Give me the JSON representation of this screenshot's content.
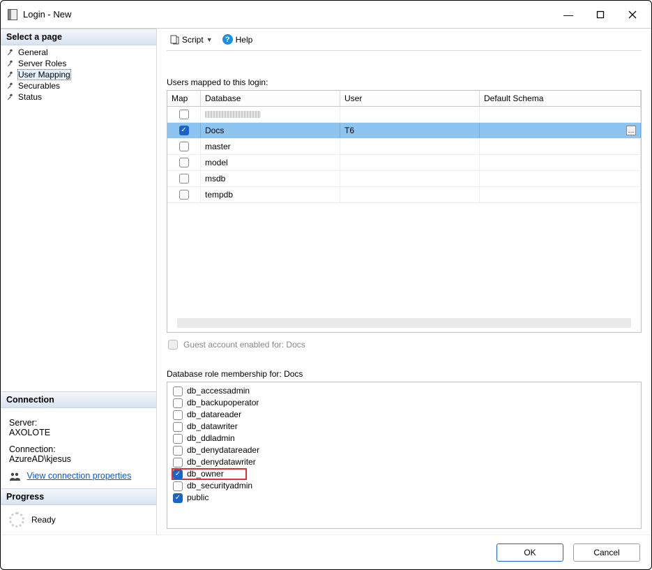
{
  "window": {
    "title": "Login - New",
    "min": "—",
    "max": "▢",
    "close": "✕"
  },
  "left": {
    "pages_header": "Select a page",
    "pages": [
      {
        "label": "General"
      },
      {
        "label": "Server Roles"
      },
      {
        "label": "User Mapping",
        "selected": true
      },
      {
        "label": "Securables"
      },
      {
        "label": "Status"
      }
    ],
    "conn_header": "Connection",
    "server_lbl": "Server:",
    "server_val": "AXOLOTE",
    "connection_lbl": "Connection:",
    "connection_val": "AzureAD\\kjesus",
    "view_props": "View connection properties",
    "progress_header": "Progress",
    "progress_status": "Ready"
  },
  "toolbar": {
    "script": "Script",
    "help": "Help"
  },
  "map": {
    "label": "Users mapped to this login:",
    "cols": {
      "map": "Map",
      "db": "Database",
      "user": "User",
      "schema": "Default Schema"
    },
    "rows": [
      {
        "checked": false,
        "db": "",
        "user": "",
        "schema": "",
        "redacted": true
      },
      {
        "checked": true,
        "db": "Docs",
        "user": "T6",
        "schema": "",
        "selected": true,
        "ellipsis": true
      },
      {
        "checked": false,
        "db": "master",
        "user": "",
        "schema": ""
      },
      {
        "checked": false,
        "db": "model",
        "user": "",
        "schema": ""
      },
      {
        "checked": false,
        "db": "msdb",
        "user": "",
        "schema": ""
      },
      {
        "checked": false,
        "db": "tempdb",
        "user": "",
        "schema": ""
      }
    ],
    "guest_label": "Guest account enabled for: Docs"
  },
  "roles": {
    "label": "Database role membership for: Docs",
    "items": [
      {
        "name": "db_accessadmin",
        "checked": false
      },
      {
        "name": "db_backupoperator",
        "checked": false
      },
      {
        "name": "db_datareader",
        "checked": false
      },
      {
        "name": "db_datawriter",
        "checked": false
      },
      {
        "name": "db_ddladmin",
        "checked": false
      },
      {
        "name": "db_denydatareader",
        "checked": false
      },
      {
        "name": "db_denydatawriter",
        "checked": false
      },
      {
        "name": "db_owner",
        "checked": true,
        "highlight": true
      },
      {
        "name": "db_securityadmin",
        "checked": false
      },
      {
        "name": "public",
        "checked": true
      }
    ]
  },
  "footer": {
    "ok": "OK",
    "cancel": "Cancel"
  }
}
